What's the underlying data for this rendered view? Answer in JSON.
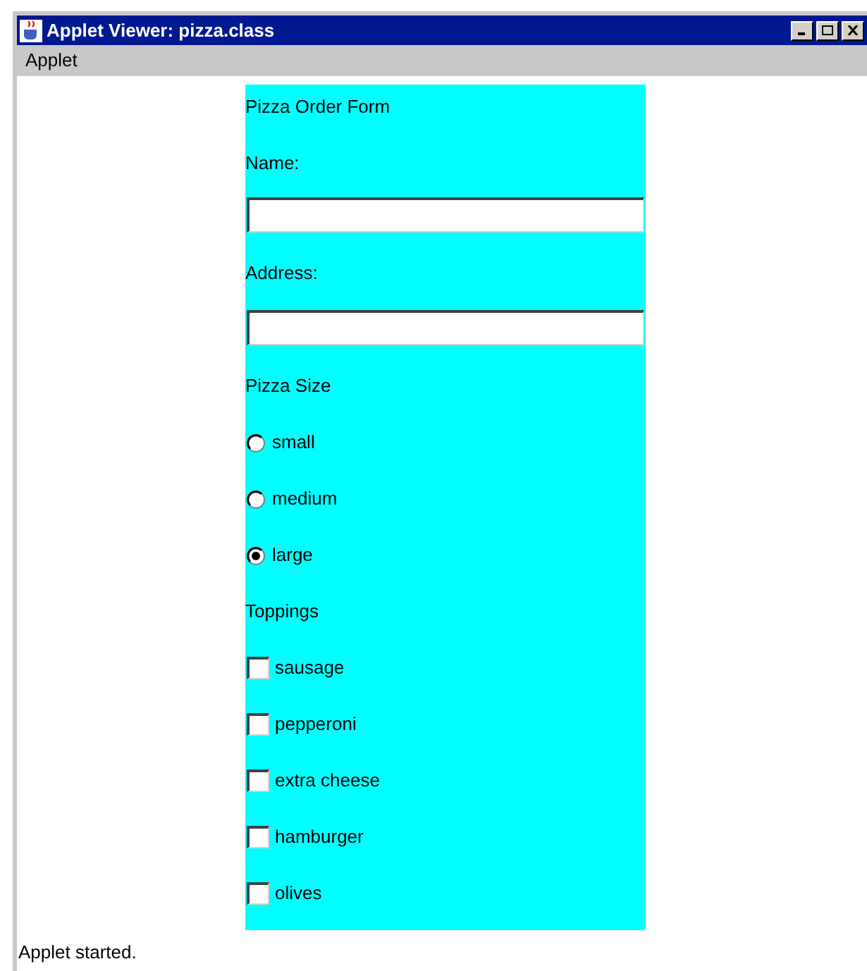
{
  "window": {
    "title": "Applet Viewer: pizza.class"
  },
  "menu": [
    "Applet"
  ],
  "form": {
    "title": "Pizza Order Form",
    "fields": [
      {
        "label": "Name:"
      },
      {
        "label": "Address:"
      }
    ],
    "size_label": "Pizza Size",
    "sizes": [
      {
        "label": "small",
        "selected": false
      },
      {
        "label": "medium",
        "selected": false
      },
      {
        "label": "large",
        "selected": true
      }
    ],
    "toppings_label": "Toppings",
    "toppings": [
      {
        "label": "sausage",
        "checked": false
      },
      {
        "label": "pepperoni",
        "checked": false
      },
      {
        "label": "extra cheese",
        "checked": false
      },
      {
        "label": "hamburger",
        "checked": false
      },
      {
        "label": "olives",
        "checked": false
      }
    ]
  },
  "status_bar": "Applet started."
}
